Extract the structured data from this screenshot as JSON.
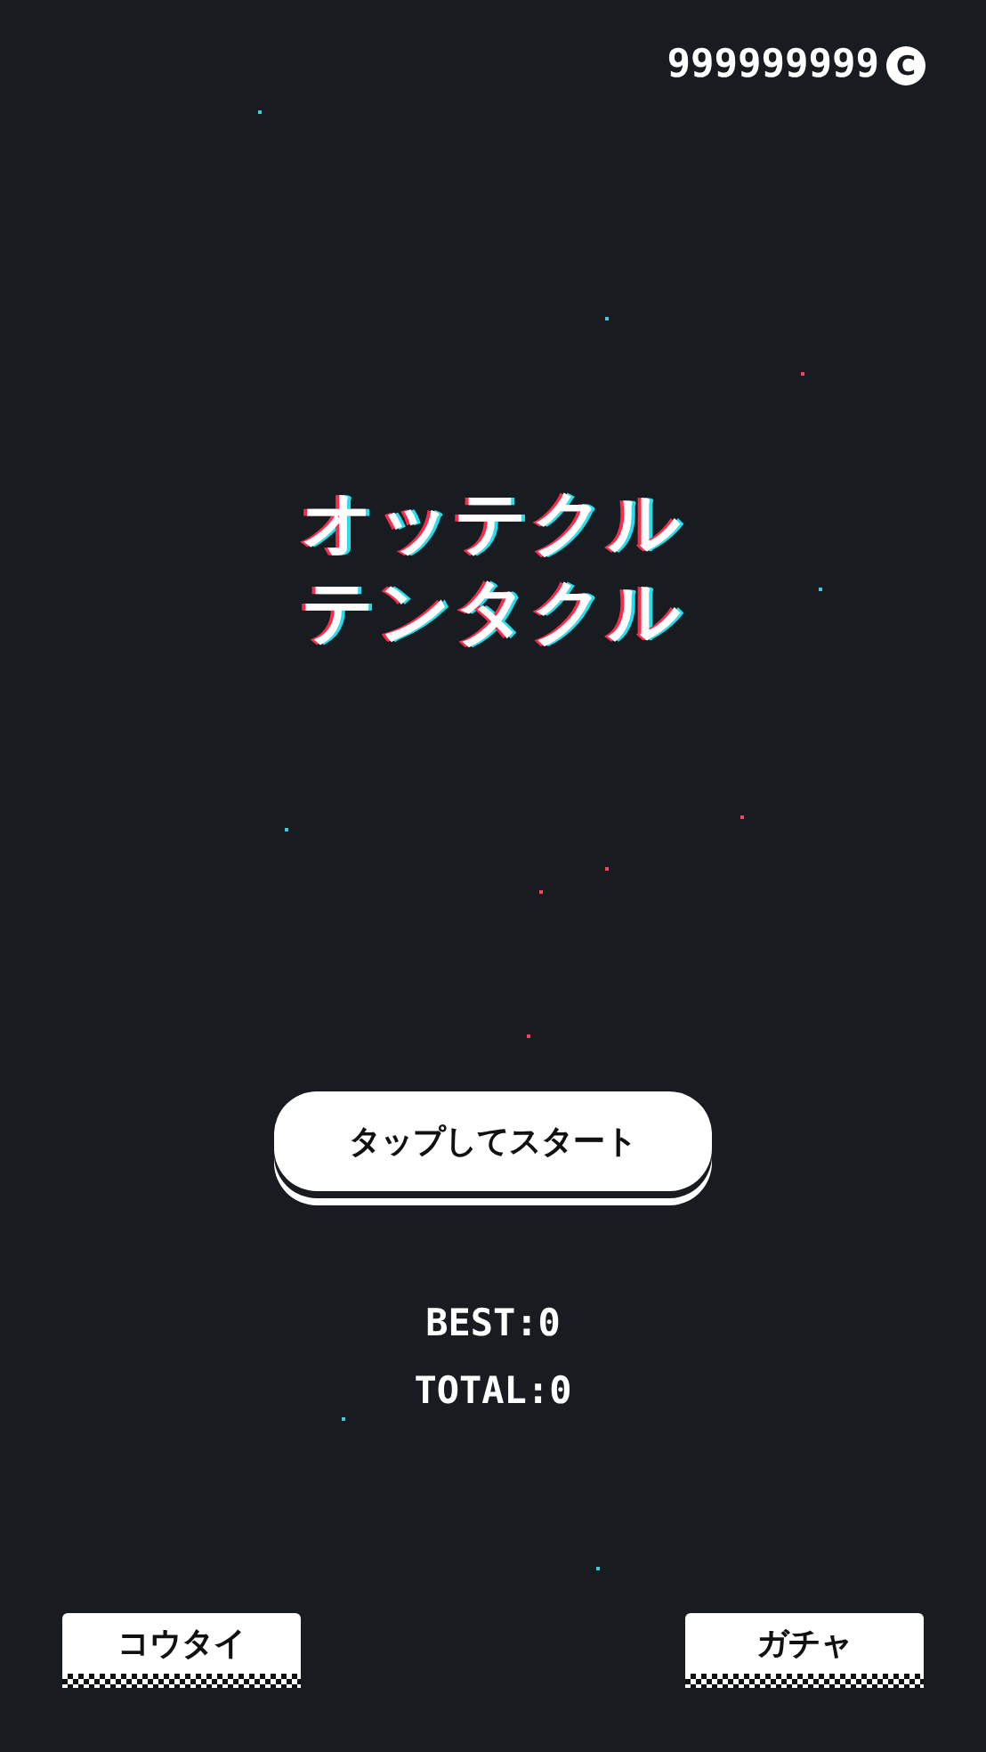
{
  "coins": {
    "amount": "999999999",
    "icon": "C"
  },
  "title": {
    "lines": [
      "オッテクル",
      "テンタクル"
    ]
  },
  "start_button": {
    "label": "タップしてスタート"
  },
  "scores": [
    {
      "label": "BEST:0"
    },
    {
      "label": "TOTAL:0"
    }
  ],
  "bottom_buttons": [
    {
      "label": "コウタイ"
    },
    {
      "label": "ガチャ"
    }
  ]
}
